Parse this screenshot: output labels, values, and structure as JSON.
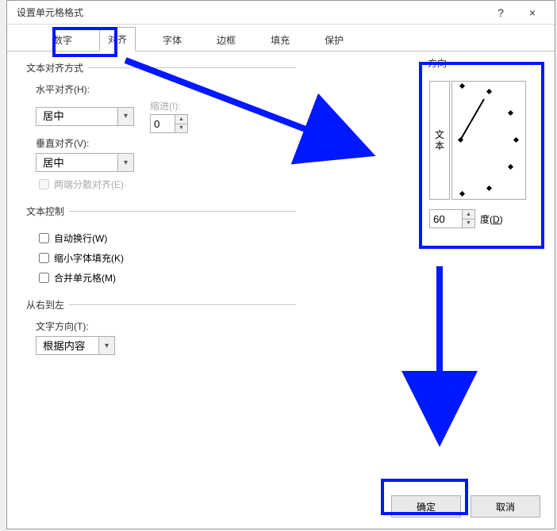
{
  "window": {
    "title": "设置单元格格式",
    "help_symbol": "?",
    "close_symbol": "×"
  },
  "tabs": {
    "items": [
      {
        "label": "数字",
        "active": false
      },
      {
        "label": "对齐",
        "active": true
      },
      {
        "label": "字体",
        "active": false
      },
      {
        "label": "边框",
        "active": false
      },
      {
        "label": "填充",
        "active": false
      },
      {
        "label": "保护",
        "active": false
      }
    ]
  },
  "alignment": {
    "group_label": "文本对齐方式",
    "horizontal_label": "水平对齐(H):",
    "horizontal_value": "居中",
    "indent_label": "缩进(I):",
    "indent_value": "0",
    "vertical_label": "垂直对齐(V):",
    "vertical_value": "居中",
    "justify_distributed_label": "两端分散对齐(E)"
  },
  "text_control": {
    "group_label": "文本控制",
    "wrap_label": "自动换行(W)",
    "shrink_label": "缩小字体填充(K)",
    "merge_label": "合并单元格(M)"
  },
  "rtl": {
    "group_label": "从右到左",
    "direction_label": "文字方向(T):",
    "direction_value": "根据内容"
  },
  "orientation": {
    "group_label": "方向",
    "vertical_text": "文本",
    "degrees_value": "60",
    "degrees_label_pre": "度(",
    "degrees_label_u": "D",
    "degrees_label_post": ")"
  },
  "buttons": {
    "ok": "确定",
    "cancel": "取消"
  }
}
